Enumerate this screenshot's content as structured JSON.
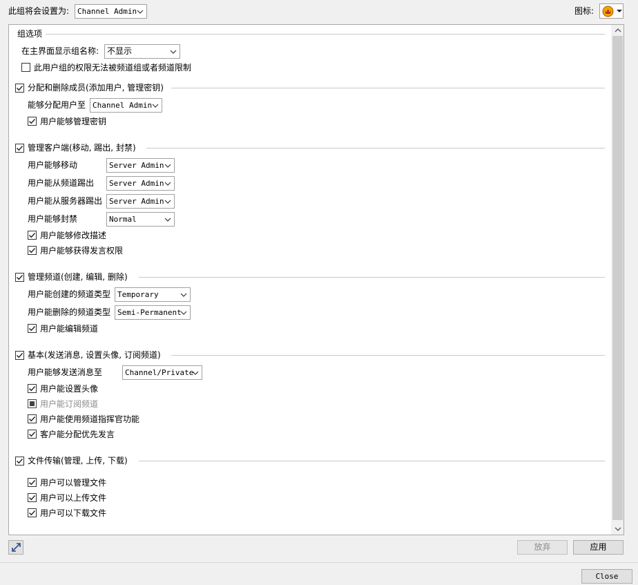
{
  "header": {
    "group_set_label": "此组将会设置为:",
    "group_set_value": "Channel Admin",
    "icon_label": "图标:"
  },
  "group_options": {
    "title": "组选项",
    "show_name_label": "在主界面显示组名称:",
    "show_name_value": "不显示",
    "no_override_label": "此用户组的权限无法被频道组或者频道限制"
  },
  "members": {
    "title": "分配和删除成员(添加用户, 管理密钥)",
    "assign_label": "能够分配用户至",
    "assign_value": "Channel Admin",
    "manage_keys_label": "用户能够管理密钥"
  },
  "clients": {
    "title": "管理客户端(移动, 踢出, 封禁)",
    "move_label": "用户能够移动",
    "move_value": "Server Admin",
    "kick_channel_label": "用户能从频道踢出",
    "kick_channel_value": "Server Admin",
    "kick_server_label": "用户能从服务器踢出",
    "kick_server_value": "Server Admin",
    "ban_label": "用户能够封禁",
    "ban_value": "Normal",
    "edit_desc_label": "用户能够修改描述",
    "talk_power_label": "用户能够获得发言权限"
  },
  "channels": {
    "title": "管理频道(创建, 编辑, 删除)",
    "create_label": "用户能创建的频道类型",
    "create_value": "Temporary",
    "delete_label": "用户能删除的频道类型",
    "delete_value": "Semi-Permanent",
    "edit_label": "用户能编辑频道"
  },
  "basic": {
    "title": "基本(发送消息, 设置头像, 订阅频道)",
    "send_label": "用户能够发送消息至",
    "send_value": "Channel/Private",
    "avatar_label": "用户能设置头像",
    "subscribe_label": "用户能订阅频道",
    "commander_label": "用户能使用频道指挥官功能",
    "priority_label": "客户能分配优先发言"
  },
  "files": {
    "title": "文件传输(管理, 上传, 下载)",
    "manage_label": "用户可以管理文件",
    "upload_label": "用户可以上传文件",
    "download_label": "用户可以下载文件"
  },
  "buttons": {
    "discard": "放弃",
    "apply": "应用",
    "close": "Close"
  },
  "colors": {
    "accent_icon": "#e08a00",
    "icon_red": "#c62828"
  }
}
